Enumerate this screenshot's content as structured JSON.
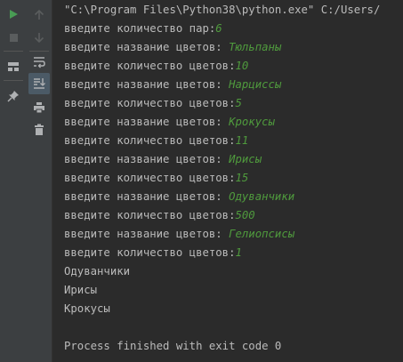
{
  "toolbar": {
    "left_icons": [
      {
        "name": "run-icon",
        "color": "#499c54"
      },
      {
        "name": "stop-icon",
        "color": "#5a5d5e"
      },
      {
        "name": "layout-icon"
      },
      {
        "name": "pin-icon"
      }
    ],
    "second_icons": [
      {
        "name": "up-arrow-icon"
      },
      {
        "name": "down-arrow-icon"
      },
      {
        "name": "soft-wrap-icon"
      },
      {
        "name": "scroll-to-end-icon"
      },
      {
        "name": "print-icon"
      },
      {
        "name": "trash-icon"
      }
    ]
  },
  "console": {
    "command": "\"C:\\Program Files\\Python38\\python.exe\" C:/Users/",
    "lines": [
      {
        "prompt": "введите количество пар:",
        "input": "6"
      },
      {
        "prompt": "введите название цветов: ",
        "input": "Тюльпаны"
      },
      {
        "prompt": "введите количество цветов:",
        "input": "10"
      },
      {
        "prompt": "введите название цветов: ",
        "input": "Нарциссы"
      },
      {
        "prompt": "введите количество цветов:",
        "input": "5"
      },
      {
        "prompt": "введите название цветов: ",
        "input": "Крокусы"
      },
      {
        "prompt": "введите количество цветов:",
        "input": "11"
      },
      {
        "prompt": "введите название цветов: ",
        "input": "Ирисы"
      },
      {
        "prompt": "введите количество цветов:",
        "input": "15"
      },
      {
        "prompt": "введите название цветов: ",
        "input": "Одуванчики"
      },
      {
        "prompt": "введите количество цветов:",
        "input": "500"
      },
      {
        "prompt": "введите название цветов: ",
        "input": "Гелиопсисы"
      },
      {
        "prompt": "введите количество цветов:",
        "input": "1"
      }
    ],
    "outputs": [
      "Одуванчики",
      "Ирисы",
      "Крокусы"
    ],
    "exit_message": "Process finished with exit code 0",
    "colors": {
      "background": "#2b2b2b",
      "text": "#bbbbbb",
      "user_input": "#4f9a3d"
    }
  }
}
